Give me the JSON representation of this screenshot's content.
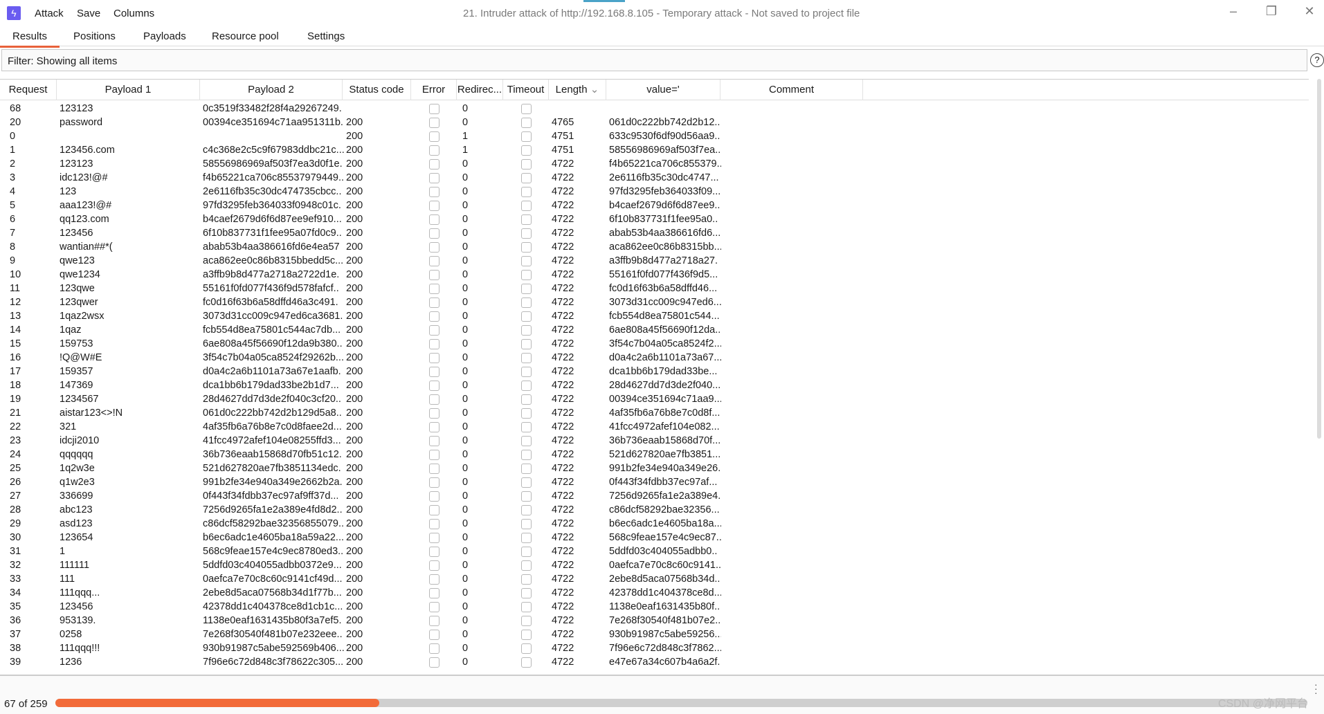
{
  "app": {
    "title": "21. Intruder attack of http://192.168.8.105 - Temporary attack - Not saved to project file",
    "menu": [
      "Attack",
      "Save",
      "Columns"
    ],
    "window_controls": [
      "minimize",
      "restore",
      "close"
    ],
    "accent": "#e8613a",
    "logo_color": "#6a5cf0"
  },
  "tabs": [
    {
      "label": "Results",
      "active": true
    },
    {
      "label": "Positions"
    },
    {
      "label": "Payloads"
    },
    {
      "label": "Resource pool"
    },
    {
      "label": "Settings"
    }
  ],
  "filter": {
    "text": "Filter: Showing all items",
    "help_icon": "?"
  },
  "columns": [
    "Request",
    "Payload 1",
    "Payload 2",
    "Status code",
    "Error",
    "Redirec...",
    "Timeout",
    "Length",
    "value='",
    "Comment"
  ],
  "sort_column": "Length",
  "rows": [
    [
      "68",
      "123123",
      "0c3519f33482f28f4a29267249.",
      "",
      "0",
      "",
      ""
    ],
    [
      "20",
      "password",
      "00394ce351694c71aa951311b.",
      "200",
      "0",
      "4765",
      "061d0c222bb742d2b12.."
    ],
    [
      "0",
      "",
      "",
      "200",
      "1",
      "4751",
      "633c9530f6df90d56aa9.."
    ],
    [
      "1",
      "123456.com",
      "c4c368e2c5c9f67983ddbc21c...",
      "200",
      "1",
      "4751",
      "58556986969af503f7ea.."
    ],
    [
      "2",
      "123123",
      "58556986969af503f7ea3d0f1e.",
      "200",
      "0",
      "4722",
      "f4b65221ca706c855379.."
    ],
    [
      "3",
      "idc123!@#",
      "f4b65221ca706c85537979449..",
      "200",
      "0",
      "4722",
      "2e6116fb35c30dc4747..."
    ],
    [
      "4",
      "123",
      "2e6116fb35c30dc474735cbcc..",
      "200",
      "0",
      "4722",
      "97fd3295feb364033f09..."
    ],
    [
      "5",
      "aaa123!@#",
      "97fd3295feb364033f0948c01c.",
      "200",
      "0",
      "4722",
      "b4caef2679d6f6d87ee9.."
    ],
    [
      "6",
      "qq123.com",
      "b4caef2679d6f6d87ee9ef910...",
      "200",
      "0",
      "4722",
      "6f10b837731f1fee95a0.."
    ],
    [
      "7",
      "123456",
      "6f10b837731f1fee95a07fd0c9..",
      "200",
      "0",
      "4722",
      "abab53b4aa386616fd6..."
    ],
    [
      "8",
      "wantian##*(",
      "abab53b4aa386616fd6e4ea57",
      "200",
      "0",
      "4722",
      "aca862ee0c86b8315bb..."
    ],
    [
      "9",
      "qwe123",
      "aca862ee0c86b8315bbedd5c...",
      "200",
      "0",
      "4722",
      "a3ffb9b8d477a2718a27."
    ],
    [
      "10",
      "qwe1234",
      "a3ffb9b8d477a2718a2722d1e.",
      "200",
      "0",
      "4722",
      "55161f0fd077f436f9d5..."
    ],
    [
      "11",
      "123qwe",
      "55161f0fd077f436f9d578fafcf..",
      "200",
      "0",
      "4722",
      "fc0d16f63b6a58dffd46..."
    ],
    [
      "12",
      "123qwer",
      "fc0d16f63b6a58dffd46a3c491.",
      "200",
      "0",
      "4722",
      "3073d31cc009c947ed6..."
    ],
    [
      "13",
      "1qaz2wsx",
      "3073d31cc009c947ed6ca3681.",
      "200",
      "0",
      "4722",
      "fcb554d8ea75801c544..."
    ],
    [
      "14",
      "1qaz",
      "fcb554d8ea75801c544ac7db...",
      "200",
      "0",
      "4722",
      "6ae808a45f56690f12da.."
    ],
    [
      "15",
      "159753",
      "6ae808a45f56690f12da9b380..",
      "200",
      "0",
      "4722",
      "3f54c7b04a05ca8524f2..."
    ],
    [
      "16",
      "!Q@W#E",
      "3f54c7b04a05ca8524f29262b...",
      "200",
      "0",
      "4722",
      "d0a4c2a6b1101a73a67..."
    ],
    [
      "17",
      "159357",
      "d0a4c2a6b1101a73a67e1aafb.",
      "200",
      "0",
      "4722",
      "dca1bb6b179dad33be..."
    ],
    [
      "18",
      "147369",
      "dca1bb6b179dad33be2b1d7...",
      "200",
      "0",
      "4722",
      "28d4627dd7d3de2f040..."
    ],
    [
      "19",
      "1234567",
      "28d4627dd7d3de2f040c3cf20..",
      "200",
      "0",
      "4722",
      "00394ce351694c71aa9..."
    ],
    [
      "21",
      "aistar123<>!N",
      "061d0c222bb742d2b129d5a8..",
      "200",
      "0",
      "4722",
      "4af35fb6a76b8e7c0d8f..."
    ],
    [
      "22",
      "321",
      "4af35fb6a76b8e7c0d8faee2d...",
      "200",
      "0",
      "4722",
      "41fcc4972afef104e082..."
    ],
    [
      "23",
      "idcji2010",
      "41fcc4972afef104e08255ffd3...",
      "200",
      "0",
      "4722",
      "36b736eaab15868d70f..."
    ],
    [
      "24",
      "qqqqqq",
      "36b736eaab15868d70fb51c12.",
      "200",
      "0",
      "4722",
      "521d627820ae7fb3851..."
    ],
    [
      "25",
      "1q2w3e",
      "521d627820ae7fb3851134edc.",
      "200",
      "0",
      "4722",
      "991b2fe34e940a349e26."
    ],
    [
      "26",
      "q1w2e3",
      "991b2fe34e940a349e2662b2a.",
      "200",
      "0",
      "4722",
      "0f443f34fdbb37ec97af..."
    ],
    [
      "27",
      "336699",
      "0f443f34fdbb37ec97af9ff37d...",
      "200",
      "0",
      "4722",
      "7256d9265fa1e2a389e4."
    ],
    [
      "28",
      "abc123",
      "7256d9265fa1e2a389e4fd8d2..",
      "200",
      "0",
      "4722",
      "c86dcf58292bae32356..."
    ],
    [
      "29",
      "asd123",
      "c86dcf58292bae32356855079..",
      "200",
      "0",
      "4722",
      "b6ec6adc1e4605ba18a..."
    ],
    [
      "30",
      "123654",
      "b6ec6adc1e4605ba18a59a22...",
      "200",
      "0",
      "4722",
      "568c9feae157e4c9ec87..."
    ],
    [
      "31",
      "1",
      "568c9feae157e4c9ec8780ed3..",
      "200",
      "0",
      "4722",
      "5ddfd03c404055adbb0.."
    ],
    [
      "32",
      "111111",
      "5ddfd03c404055adbb0372e9...",
      "200",
      "0",
      "4722",
      "0aefca7e70c8c60c9141..."
    ],
    [
      "33",
      "111",
      "0aefca7e70c8c60c9141cf49d...",
      "200",
      "0",
      "4722",
      "2ebe8d5aca07568b34d.."
    ],
    [
      "34",
      "111qqq...",
      "2ebe8d5aca07568b34d1f77b...",
      "200",
      "0",
      "4722",
      "42378dd1c404378ce8d..."
    ],
    [
      "35",
      "123456",
      "42378dd1c404378ce8d1cb1c...",
      "200",
      "0",
      "4722",
      "1138e0eaf1631435b80f.."
    ],
    [
      "36",
      "953139.",
      "1138e0eaf1631435b80f3a7ef5.",
      "200",
      "0",
      "4722",
      "7e268f30540f481b07e2.."
    ],
    [
      "37",
      "0258",
      "7e268f30540f481b07e232eee..",
      "200",
      "0",
      "4722",
      "930b91987c5abe59256..."
    ],
    [
      "38",
      "111qqq!!!",
      "930b91987c5abe592569b406...",
      "200",
      "0",
      "4722",
      "7f96e6c72d848c3f7862..."
    ],
    [
      "39",
      "1236",
      "7f96e6c72d848c3f78622c305...",
      "200",
      "0",
      "4722",
      "e47e67a34c607b4a6a2f."
    ]
  ],
  "progress": {
    "label": "67 of 259",
    "done": 67,
    "total": 259,
    "color": "#f26b3a"
  },
  "watermark": "CSDN @净网平台"
}
